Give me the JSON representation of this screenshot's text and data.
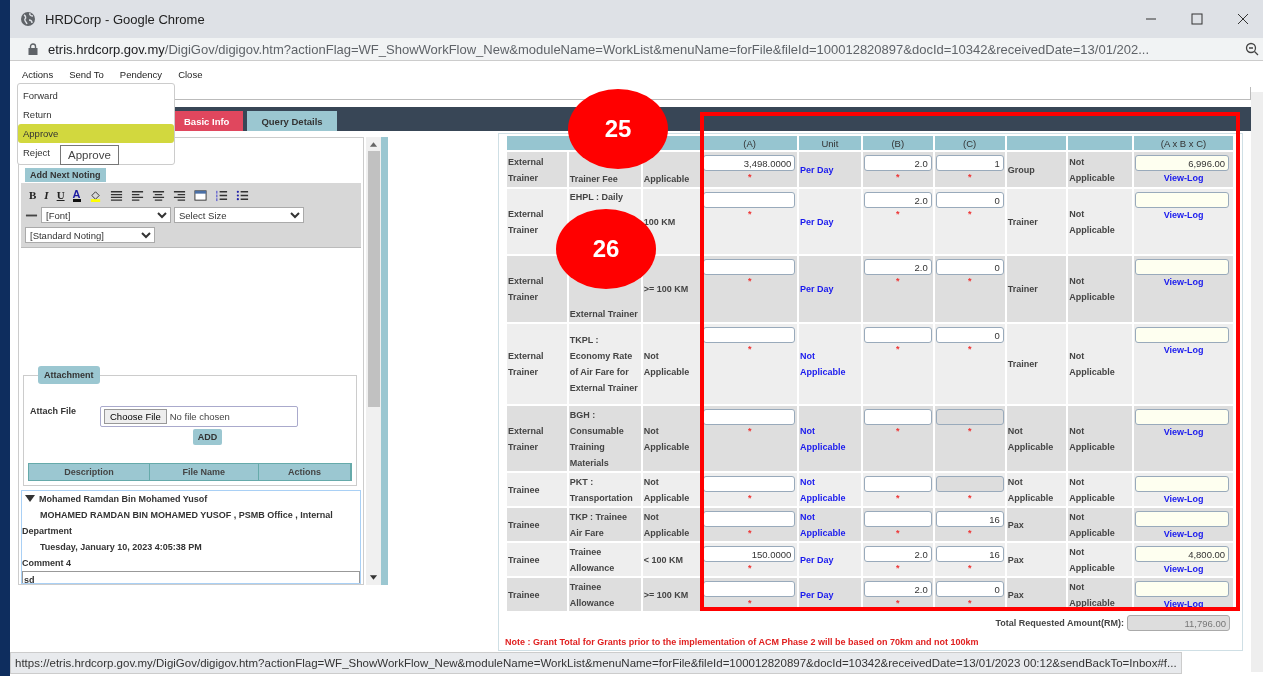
{
  "window": {
    "title": "HRDCorp - Google Chrome"
  },
  "address_bar": {
    "domain": "etris.hrdcorp.gov.my",
    "path": "/DigiGov/digigov.htm?actionFlag=WF_ShowWorkFlow_New&moduleName=WorkList&menuName=forFile&fileId=100012820897&docId=10342&receivedDate=13/01/202..."
  },
  "menu_bar": [
    "Actions",
    "Send To",
    "Pendency",
    "Close"
  ],
  "actions_menu": {
    "items": [
      {
        "label": "Forward",
        "selected": false
      },
      {
        "label": "Return",
        "selected": false
      },
      {
        "label": "Approve",
        "selected": true
      },
      {
        "label": "Reject",
        "selected": false
      }
    ],
    "tooltip": "Approve"
  },
  "tabs": [
    {
      "label": "Basic Info",
      "selected": true
    },
    {
      "label": "Query Details",
      "selected": false
    }
  ],
  "noting": {
    "add_button": "Add Next Noting",
    "format_buttons": [
      "B",
      "I",
      "U"
    ],
    "font_color_button": "A",
    "font_select": "[Font]",
    "size_select": "Select Size",
    "template_select": "[Standard Noting]"
  },
  "attachment": {
    "legend": "Attachment",
    "label": "Attach File",
    "choose_button": "Choose File",
    "file_status": "No file chosen",
    "add_button": "ADD",
    "columns": [
      "Description",
      "File Name",
      "Actions"
    ]
  },
  "comments": [
    {
      "author": "Mohamed Ramdan Bin Mohamed Yusof",
      "expanded": true,
      "detail": "MOHAMED RAMDAN BIN MOHAMED YUSOF , PSMB Office , Internal Department",
      "date": "Tuesday, January 10, 2023 4:05:38 PM",
      "title": "Comment 4",
      "body": "sd"
    }
  ],
  "grant_table": {
    "header": {
      "a": "(A)",
      "unit": "Unit",
      "b": "(B)",
      "c": "(C)",
      "total": "(A x B x C)"
    },
    "rows": [
      {
        "category": "External Trainer",
        "item": "Trainer Fee",
        "distance": "Applicable",
        "a": {
          "value": "3,498.0000",
          "mark": "*"
        },
        "unit": "Per Day",
        "b": {
          "value": "2.0",
          "mark": "*"
        },
        "c": {
          "value": "1",
          "mark": "*"
        },
        "per": "Group",
        "status": "Not Applicable",
        "total": {
          "value": "6,996.00"
        },
        "link": "View-Log"
      },
      {
        "category": "External Trainer",
        "item": "EHPL : Daily",
        "distance": "100 KM",
        "a": {
          "mark": "*"
        },
        "unit": "Per Day",
        "b": {
          "value": "2.0",
          "mark": "*"
        },
        "c": {
          "value": "0",
          "mark": "*"
        },
        "per": "Trainer",
        "status": "Not Applicable",
        "total": {},
        "link": "View-Log"
      },
      {
        "category": "External Trainer",
        "item": "External Trainer",
        "distance": ">= 100 KM",
        "a": {
          "mark": "*"
        },
        "unit": "Per Day",
        "b": {
          "value": "2.0",
          "mark": "*"
        },
        "c": {
          "value": "0",
          "mark": "*"
        },
        "per": "Trainer",
        "status": "Not Applicable",
        "total": {},
        "link": "View-Log"
      },
      {
        "category": "External Trainer",
        "item": "TKPL : Economy Rate of Air Fare for External Trainer",
        "distance": "Not Applicable",
        "a": {
          "mark": "*"
        },
        "unit": "Not Applicable",
        "b": {
          "mark": "*"
        },
        "c": {
          "value": "0",
          "mark": "*"
        },
        "per": "Trainer",
        "status": "Not Applicable",
        "total": {},
        "link": "View-Log"
      },
      {
        "category": "External Trainer",
        "item": "BGH : Consumable Training Materials",
        "distance": "Not Applicable",
        "a": {
          "mark": "*"
        },
        "unit": "Not Applicable",
        "b": {
          "mark": "*"
        },
        "c": {
          "mark": "*",
          "disabled": true
        },
        "per": "Not Applicable",
        "status": "Not Applicable",
        "total": {},
        "link": "View-Log"
      },
      {
        "category": "Trainee",
        "item": "PKT : Transportation",
        "distance": "Not Applicable",
        "a": {
          "mark": "*"
        },
        "unit": "Not Applicable",
        "b": {
          "mark": "*"
        },
        "c": {
          "mark": "*",
          "disabled": true
        },
        "per": "Not Applicable",
        "status": "Not Applicable",
        "total": {},
        "link": "View-Log"
      },
      {
        "category": "Trainee",
        "item": "TKP : Trainee Air Fare",
        "distance": "Not Applicable",
        "a": {
          "mark": "*"
        },
        "unit": "Not Applicable",
        "b": {
          "mark": "*"
        },
        "c": {
          "value": "16",
          "mark": "*"
        },
        "per": "Pax",
        "status": "Not Applicable",
        "total": {},
        "link": "View-Log"
      },
      {
        "category": "Trainee",
        "item": "Trainee Allowance",
        "distance": "< 100 KM",
        "a": {
          "value": "150.0000",
          "mark": "*"
        },
        "unit": "Per Day",
        "b": {
          "value": "2.0",
          "mark": "*"
        },
        "c": {
          "value": "16",
          "mark": "*"
        },
        "per": "Pax",
        "status": "Not Applicable",
        "total": {
          "value": "4,800.00"
        },
        "link": "View-Log"
      },
      {
        "category": "Trainee",
        "item": "Trainee Allowance",
        "distance": ">= 100 KM",
        "a": {
          "mark": "*"
        },
        "unit": "Per Day",
        "b": {
          "value": "2.0",
          "mark": "*"
        },
        "c": {
          "value": "0",
          "mark": "*"
        },
        "per": "Pax",
        "status": "Not Applicable",
        "total": {},
        "link": "View-Log"
      }
    ],
    "total_label": "Total Requested Amount(RM):",
    "total": "11,796.00",
    "note": "Note : Grant Total for Grants prior to the implementation of ACM Phase 2 will be based on 70km and not 100km"
  },
  "callouts": [
    "25",
    "26"
  ],
  "status_url": "https://etris.hrdcorp.gov.my/DigiGov/digigov.htm?actionFlag=WF_ShowWorkFlow_New&moduleName=WorkList&menuName=forFile&fileId=100012820897&docId=10342&receivedDate=13/01/2023 00:12&sendBackTo=Inbox#f..."
}
